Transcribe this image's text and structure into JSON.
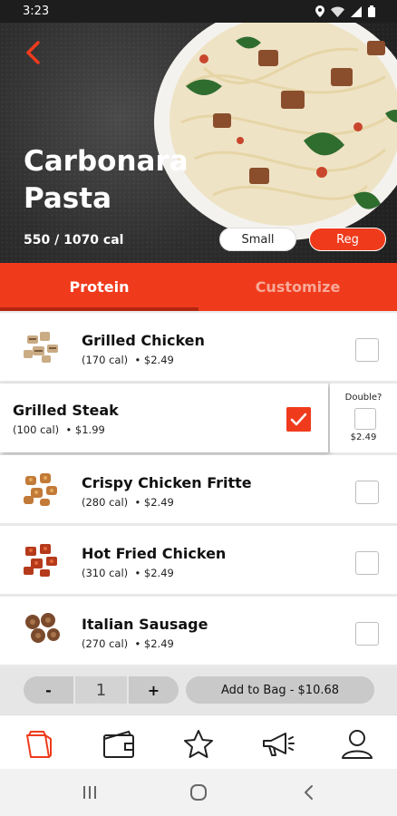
{
  "status_bar": {
    "time": "3:23"
  },
  "item": {
    "title": "Carbonara\nPasta",
    "calories": "550 / 1070 cal",
    "sizes": {
      "small": "Small",
      "regular": "Reg",
      "selected": "Reg"
    }
  },
  "tabs": {
    "protein": "Protein",
    "customize": "Customize",
    "active": "Protein"
  },
  "proteins": [
    {
      "name": "Grilled Chicken",
      "cal": "(170 cal)",
      "price": "• $2.49",
      "checked": false
    },
    {
      "name": "Grilled Steak",
      "cal": "(100 cal)",
      "price": "• $1.99",
      "checked": true,
      "double_label": "Double?",
      "double_price": "$2.49"
    },
    {
      "name": "Crispy Chicken Fritte",
      "cal": "(280 cal)",
      "price": "• $2.49",
      "checked": false
    },
    {
      "name": "Hot Fried Chicken",
      "cal": "(310 cal)",
      "price": "• $2.49",
      "checked": false
    },
    {
      "name": "Italian Sausage",
      "cal": "(270 cal)",
      "price": "• $2.49",
      "checked": false
    }
  ],
  "quantity": {
    "minus": "-",
    "value": "1",
    "plus": "+"
  },
  "add_to_bag": "Add to Bag - $10.68",
  "bottom_nav": [
    "bag-icon",
    "wallet-icon",
    "star-icon",
    "megaphone-icon",
    "profile-icon"
  ],
  "colors": {
    "accent": "#ef3b1c",
    "hero_bg": "#2e2e2e"
  }
}
